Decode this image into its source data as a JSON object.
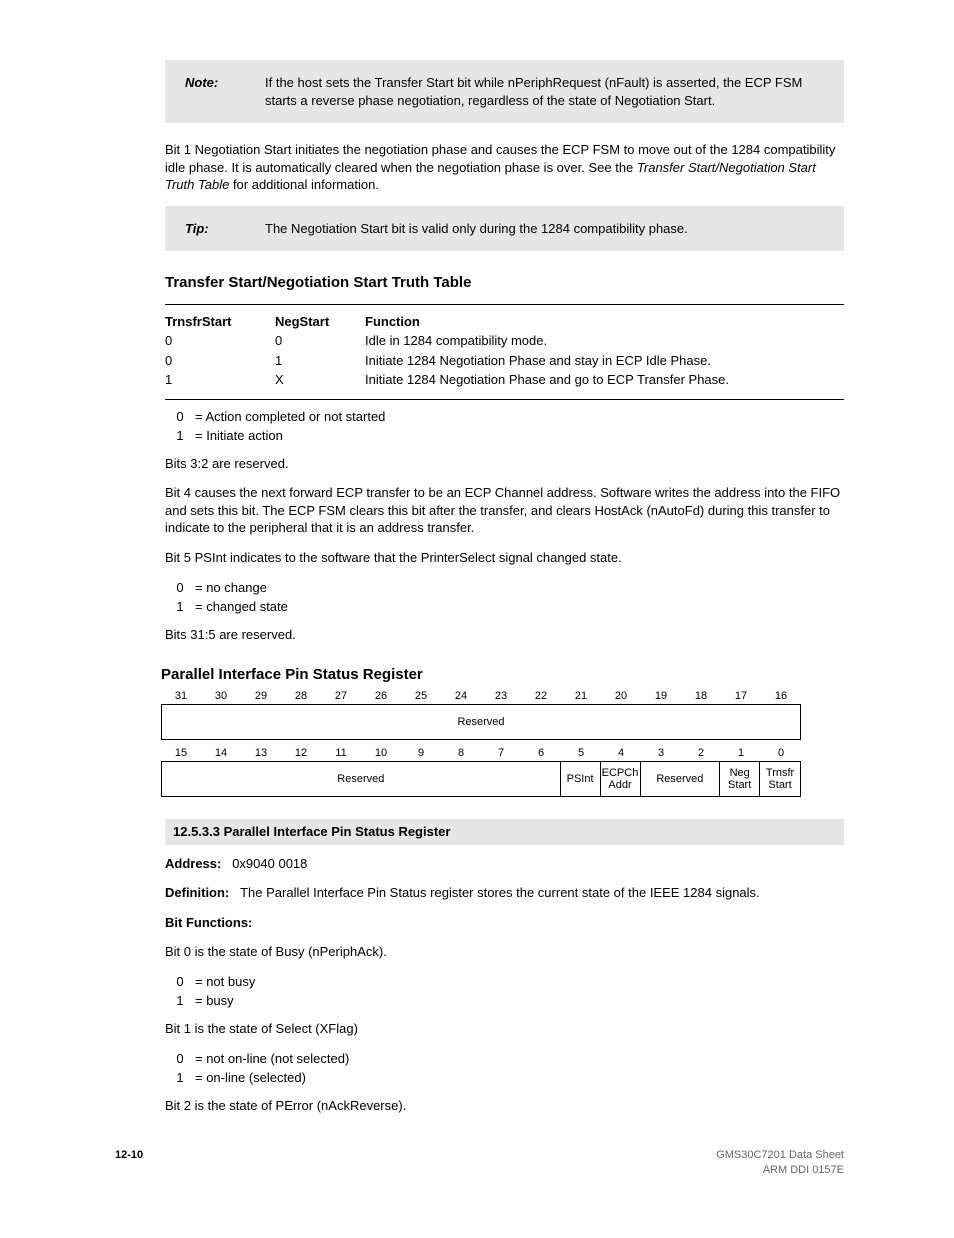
{
  "note": {
    "label": "Note:",
    "text": "If the host sets the Transfer Start bit while nPeriphRequest (nFault) is asserted, the ECP FSM starts a reverse phase negotiation, regardless of the state of Negotiation Start."
  },
  "para1": "Bit 1 Negotiation Start initiates the negotiation phase and causes the ECP FSM to move out of the 1284 compatibility idle phase. It is automatically cleared when the negotiation phase is over. See the ",
  "para1_link": "Transfer Start/Negotiation Start Truth Table",
  "para1_after": " for additional information.",
  "tip": {
    "label": "Tip:",
    "text": "The Negotiation Start bit is valid only during the 1284 compatibility phase."
  },
  "truth_table": {
    "heading": "Transfer Start/Negotiation Start Truth Table",
    "cols": [
      "TrnsfrStart",
      "NegStart",
      "Function"
    ],
    "rows": [
      [
        "0",
        "0",
        "Idle in 1284 compatibility mode."
      ],
      [
        "0",
        "1",
        "Initiate 1284 Negotiation Phase and stay in ECP Idle Phase."
      ],
      [
        "1",
        "X",
        "Initiate 1284 Negotiation Phase and go to ECP Transfer Phase."
      ]
    ]
  },
  "defs": [
    [
      "0",
      "Action completed or not started"
    ],
    [
      "1",
      "Initiate action"
    ]
  ],
  "para2a": "Bits 3:2 are reserved.",
  "para2b": "Bit 4 causes the next forward ECP transfer to be an ECP Channel address. Software writes the address into the FIFO and sets this bit. The ECP FSM clears this bit after the transfer, and clears HostAck (nAutoFd) during this transfer to indicate to the peripheral that it is an address transfer.",
  "para2c": "Bit 5 PSInt indicates to the software that the PrinterSelect signal changed state.",
  "def2": [
    [
      "0",
      "no change"
    ],
    [
      "1",
      "changed state"
    ]
  ],
  "para2d": "Bits 31:5 are reserved.",
  "register": {
    "name": "Parallel Interface Pin Status Register",
    "top_nums": [
      "31",
      "30",
      "29",
      "28",
      "27",
      "26",
      "25",
      "24",
      "23",
      "22",
      "21",
      "20",
      "19",
      "18",
      "17",
      "16"
    ],
    "top_cell": "Reserved",
    "bot_nums": [
      "15",
      "14",
      "13",
      "12",
      "11",
      "10",
      "9",
      "8",
      "7",
      "6",
      "5",
      "4",
      "3",
      "2",
      "1",
      "0"
    ],
    "bot_cells": [
      {
        "w": 10,
        "t": "Reserved"
      },
      {
        "w": 1,
        "t": "PSInt"
      },
      {
        "w": 1,
        "t": "ECPCh Addr"
      },
      {
        "w": 2,
        "t": "Reserved"
      },
      {
        "w": 1,
        "t": "Neg Start"
      },
      {
        "w": 1,
        "t": "Trnsfr Start"
      }
    ]
  },
  "pin_section": {
    "heading": "12.5.3.3 Parallel Interface Pin Status Register",
    "addr_label": "Address:",
    "addr_value": "0x9040 0018",
    "def_label": "Definition:",
    "def_value": "The Parallel Interface Pin Status register stores the current state of the IEEE 1284 signals.",
    "bitfn_label": "Bit Functions:",
    "bits": [
      {
        "h": "Bit 0 is the state of Busy (nPeriphAck).",
        "v": [
          [
            "0",
            "not busy"
          ],
          [
            "1",
            "busy"
          ]
        ]
      },
      {
        "h": "Bit 1 is the state of Select (XFlag)",
        "v": [
          [
            "0",
            "not on-line (not selected)"
          ],
          [
            "1",
            "on-line (selected)"
          ]
        ]
      },
      {
        "h": "Bit 2 is the state of PError (nAckReverse)."
      }
    ]
  },
  "footer": {
    "left": "12-10",
    "right": "GMS30C7201 Data Sheet",
    "sub": "ARM DDI 0157E"
  }
}
